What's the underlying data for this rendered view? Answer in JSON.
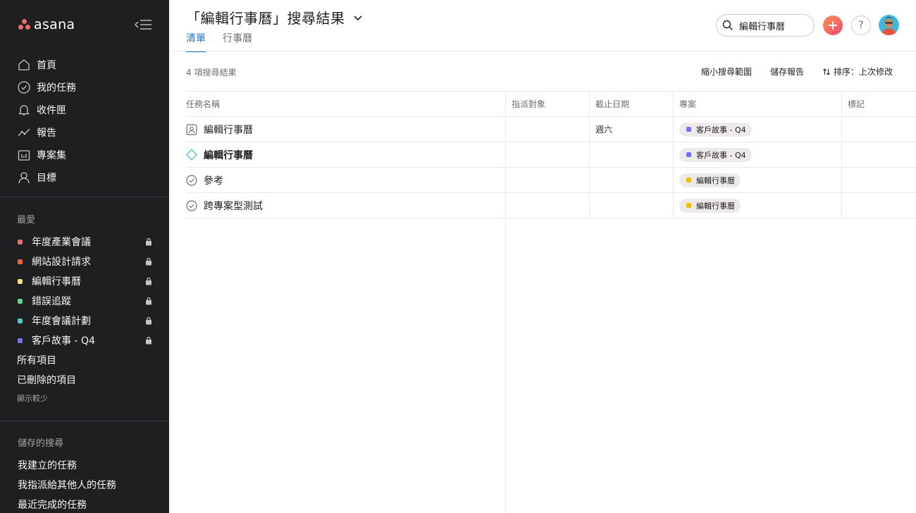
{
  "app": {
    "logo_text": "asana"
  },
  "sidebar": {
    "nav": [
      {
        "label": "首頁",
        "icon": "home-icon"
      },
      {
        "label": "我的任務",
        "icon": "check-circle-icon"
      },
      {
        "label": "收件匣",
        "icon": "bell-icon"
      },
      {
        "label": "報告",
        "icon": "trend-line-icon"
      },
      {
        "label": "專案集",
        "icon": "portfolio-icon"
      },
      {
        "label": "目標",
        "icon": "person-icon"
      }
    ],
    "favorites_title": "最愛",
    "favorites": [
      {
        "label": "年度產業會議",
        "color": "#f06a6a"
      },
      {
        "label": "網站設計請求",
        "color": "#fd612c"
      },
      {
        "label": "編輯行事曆",
        "color": "#f8df72"
      },
      {
        "label": "錯誤追蹤",
        "color": "#5cd98b"
      },
      {
        "label": "年度會議計劃",
        "color": "#4ecbc4"
      },
      {
        "label": "客戶故事 - Q4",
        "color": "#796eff"
      }
    ],
    "extra_items": [
      "所有項目",
      "已刪除的項目"
    ],
    "show_less": "顯示較少",
    "saved_searches_title": "儲存的搜尋",
    "saved_searches": [
      "我建立的任務",
      "我指派給其他人的任務",
      "最近完成的任務"
    ]
  },
  "header": {
    "title": "「編輯行事曆」搜尋結果",
    "tabs": [
      "清單",
      "行事曆"
    ],
    "search_value": "編輯行事曆",
    "help_label": "?"
  },
  "toolbar": {
    "result_count": "4 項搜尋結果",
    "refine": "縮小搜尋範圍",
    "save_report": "儲存報告",
    "sort": "排序：上次修改"
  },
  "table": {
    "columns": [
      "任務名稱",
      "指派對象",
      "截止日期",
      "專案",
      "標記"
    ],
    "rows": [
      {
        "name": "編輯行事曆",
        "icon": "approval-icon",
        "bold": false,
        "assignee": "",
        "due": "週六",
        "project": "客戶故事 - Q4",
        "project_color": "#796eff",
        "tags": ""
      },
      {
        "name": "編輯行事曆",
        "icon": "milestone-diamond-icon",
        "bold": true,
        "assignee": "",
        "due": "",
        "project": "客戶故事 - Q4",
        "project_color": "#796eff",
        "tags": ""
      },
      {
        "name": "參考",
        "icon": "check-circle-icon",
        "bold": false,
        "assignee": "",
        "due": "",
        "project": "編輯行事曆",
        "project_color": "#f1bd00",
        "tags": ""
      },
      {
        "name": "跨專案型測試",
        "icon": "check-circle-icon",
        "bold": false,
        "assignee": "",
        "due": "",
        "project": "編輯行事曆",
        "project_color": "#f1bd00",
        "tags": ""
      }
    ]
  }
}
